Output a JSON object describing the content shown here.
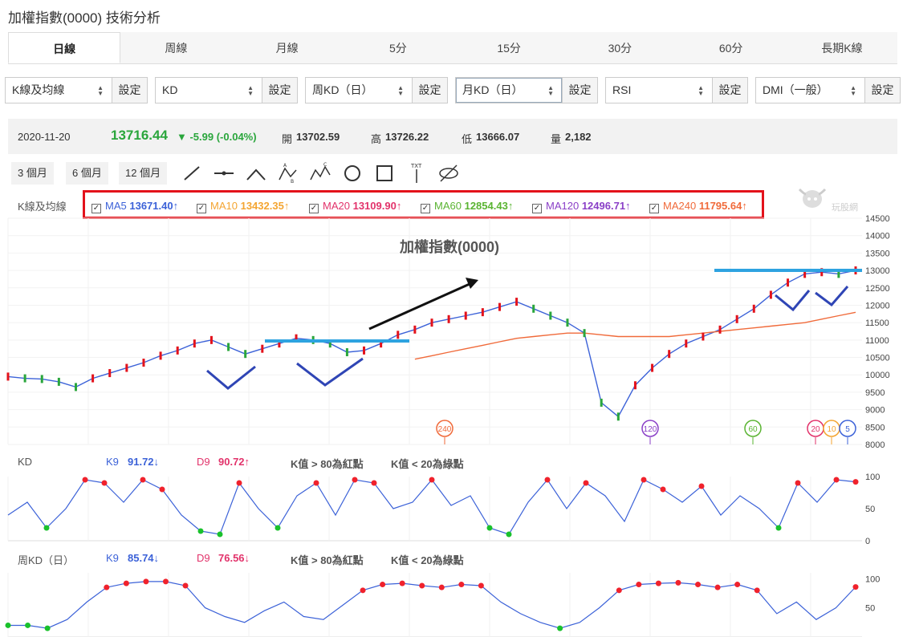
{
  "page": {
    "title": "加權指數(0000) 技術分析"
  },
  "tabs": [
    "日線",
    "周線",
    "月線",
    "5分",
    "15分",
    "30分",
    "60分",
    "長期K線"
  ],
  "selectors": [
    {
      "value": "K線及均線",
      "button": "設定"
    },
    {
      "value": "KD",
      "button": "設定"
    },
    {
      "value": "周KD（日）",
      "button": "設定"
    },
    {
      "value": "月KD（日）",
      "button": "設定"
    },
    {
      "value": "RSI",
      "button": "設定"
    },
    {
      "value": "DMI（一般）",
      "button": "設定"
    }
  ],
  "quote": {
    "date": "2020-11-20",
    "price": "13716.44",
    "change": "▼ -5.99 (-0.04%)",
    "open_label": "開",
    "open": "13702.59",
    "high_label": "高",
    "high": "13726.22",
    "low_label": "低",
    "low": "13666.07",
    "vol_label": "量",
    "vol": "2,182"
  },
  "ranges": [
    "3 個月",
    "6 個月",
    "12 個月"
  ],
  "tool_icons": [
    "line-tool-icon",
    "horizontal-line-icon",
    "angle-icon",
    "abc-pattern-icon",
    "abcd-pattern-icon",
    "circle-tool-icon",
    "rectangle-tool-icon",
    "text-tool-icon",
    "hide-icon"
  ],
  "ma_legend": {
    "label": "K線及均線",
    "items": [
      {
        "name": "MA5",
        "value": "13671.40↑",
        "color": "#3c62d8"
      },
      {
        "name": "MA10",
        "value": "13432.35↑",
        "color": "#f4a531"
      },
      {
        "name": "MA20",
        "value": "13109.90↑",
        "color": "#e2336b"
      },
      {
        "name": "MA60",
        "value": "12854.43↑",
        "color": "#5ab432"
      },
      {
        "name": "MA120",
        "value": "12496.71↑",
        "color": "#8a3fc7"
      },
      {
        "name": "MA240",
        "value": "11795.64↑",
        "color": "#f06a3a"
      }
    ]
  },
  "logo_text": "玩股網",
  "kd_legend": {
    "label": "KD",
    "k": "K9",
    "k_value": "91.72↓",
    "d": "D9",
    "d_value": "90.72↑",
    "note_red": "K值 > 80為紅點",
    "note_green": "K值 < 20為綠點"
  },
  "wkd_legend": {
    "label": "周KD（日）",
    "k": "K9",
    "k_value": "85.74↓",
    "d": "D9",
    "d_value": "76.56↓",
    "note_red": "K值 > 80為紅點",
    "note_green": "K值 < 20為綠點"
  },
  "chart_data": [
    {
      "type": "line",
      "title": "加權指數(0000)",
      "y_ticks": [
        8000,
        8500,
        9000,
        9500,
        10000,
        10500,
        11000,
        11500,
        12000,
        12500,
        13000,
        13500,
        14000,
        14500
      ],
      "ylim": [
        8000,
        14500
      ],
      "x": [
        0,
        10,
        20,
        30,
        40,
        50,
        60,
        70,
        80,
        90,
        100,
        110,
        120,
        130,
        140,
        150,
        160,
        170,
        180,
        190,
        200,
        210,
        220,
        230,
        240,
        250,
        260,
        270,
        280,
        290,
        300,
        310,
        320,
        330,
        340,
        350,
        360,
        370,
        380,
        390,
        400,
        410,
        420,
        430,
        440,
        450,
        460,
        470,
        480,
        490,
        500
      ],
      "series": [
        {
          "name": "MA5",
          "color": "#3c62d8",
          "values": [
            9950,
            9900,
            9880,
            9800,
            9650,
            9900,
            10050,
            10200,
            10350,
            10550,
            10700,
            10900,
            11000,
            10800,
            10600,
            10750,
            10900,
            11050,
            11000,
            10900,
            10650,
            10700,
            10900,
            11150,
            11300,
            11500,
            11600,
            11700,
            11800,
            11950,
            12100,
            11900,
            11700,
            11500,
            11200,
            9200,
            8800,
            9700,
            10200,
            10600,
            10900,
            11100,
            11300,
            11600,
            11900,
            12300,
            12650,
            12900,
            12950,
            12900,
            13000
          ]
        },
        {
          "name": "MA240",
          "color": "#f06a3a",
          "values": [
            null,
            null,
            null,
            null,
            null,
            null,
            null,
            null,
            null,
            null,
            null,
            null,
            null,
            null,
            null,
            null,
            null,
            null,
            null,
            null,
            null,
            null,
            null,
            null,
            10450,
            10550,
            10650,
            10750,
            10850,
            10950,
            11050,
            11100,
            11150,
            11200,
            11200,
            11150,
            11100,
            11100,
            11100,
            11100,
            11150,
            11200,
            11250,
            11300,
            11350,
            11400,
            11450,
            11500,
            11600,
            11700,
            11795.64
          ]
        }
      ],
      "markers": [
        "240",
        "120",
        "60",
        "20",
        "10",
        "5"
      ]
    },
    {
      "type": "line",
      "title": "KD",
      "y_ticks": [
        0,
        50,
        100
      ],
      "ylim": [
        0,
        100
      ],
      "series": [
        {
          "name": "K9",
          "color": "#3c62d8",
          "values": [
            40,
            60,
            20,
            50,
            95,
            90,
            60,
            95,
            80,
            40,
            15,
            10,
            90,
            50,
            20,
            70,
            90,
            40,
            95,
            90,
            50,
            60,
            95,
            55,
            70,
            20,
            10,
            60,
            95,
            50,
            90,
            70,
            30,
            95,
            80,
            60,
            85,
            40,
            70,
            50,
            20,
            90,
            60,
            95,
            91.72
          ]
        }
      ]
    },
    {
      "type": "line",
      "title": "周KD（日）",
      "y_ticks": [
        50,
        100
      ],
      "ylim": [
        0,
        110
      ],
      "series": [
        {
          "name": "K9",
          "color": "#3c62d8",
          "values": [
            20,
            20,
            15,
            30,
            60,
            85,
            92,
            95,
            95,
            88,
            50,
            35,
            25,
            45,
            60,
            35,
            30,
            55,
            80,
            90,
            92,
            88,
            85,
            90,
            88,
            60,
            40,
            25,
            15,
            25,
            50,
            80,
            90,
            92,
            93,
            90,
            85,
            90,
            80,
            40,
            60,
            30,
            50,
            85.74
          ]
        }
      ]
    }
  ]
}
